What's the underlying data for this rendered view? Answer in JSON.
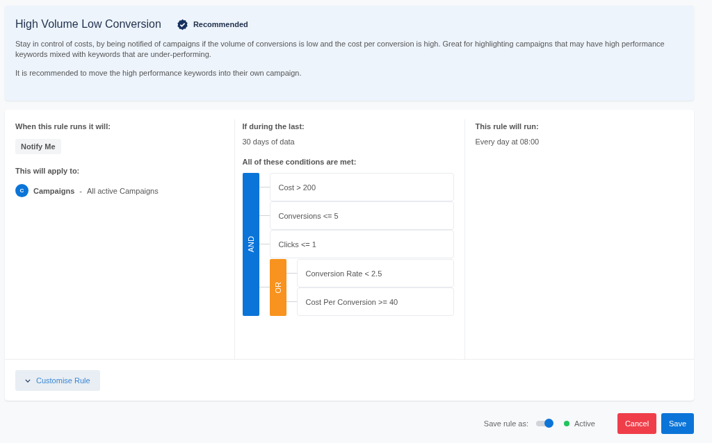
{
  "rule": {
    "title": "High Volume Low Conversion",
    "badge": "Recommended",
    "description": "Stay in control of costs, by being notified of campaigns if the volume of conversions is low and the cost per conversion is high. Great for highlighting campaigns that may have high performance keywords mixed with keywords that are under-performing.",
    "note": "It is recommended to move the high performance keywords into their own campaign."
  },
  "action": {
    "heading": "When this rule runs it will:",
    "tag": "Notify Me",
    "apply_heading": "This will apply to:",
    "target_initial": "C",
    "target_name": "Campaigns",
    "target_separator": "-",
    "target_detail": "All active Campaigns"
  },
  "period": {
    "heading": "If during the last:",
    "value": "30 days of data",
    "conditions_heading": "All of these conditions are met:"
  },
  "logic": {
    "kind": "group",
    "label": "AND",
    "color": "#0b74d8",
    "children": [
      {
        "kind": "condition",
        "text": "Cost > 200"
      },
      {
        "kind": "condition",
        "text": "Conversions <= 5"
      },
      {
        "kind": "condition",
        "text": "Clicks <= 1"
      },
      {
        "kind": "group",
        "label": "OR",
        "color": "#f7931e",
        "children": [
          {
            "kind": "condition",
            "text": "Conversion Rate < 2.5"
          },
          {
            "kind": "condition",
            "text": "Cost Per Conversion >= 40"
          }
        ]
      }
    ]
  },
  "schedule": {
    "heading": "This rule will run:",
    "value": "Every day at 08:00"
  },
  "customise": {
    "label": "Customise Rule",
    "expanded": false
  },
  "footer": {
    "save_as_label": "Save rule as:",
    "toggle_on": true,
    "status": {
      "label": "Active",
      "color": "#22c55e"
    },
    "cancel": "Cancel",
    "save": "Save"
  }
}
